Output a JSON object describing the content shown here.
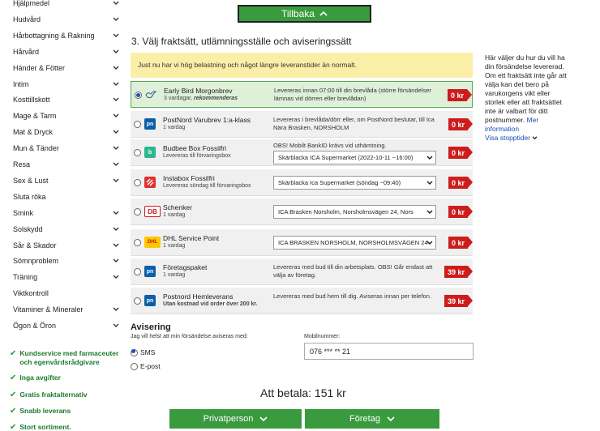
{
  "sidebar": {
    "categories": [
      {
        "label": "Hjälpmedel",
        "chevron": true
      },
      {
        "label": "Hudvård",
        "chevron": true
      },
      {
        "label": "Hårbottagning & Rakning",
        "chevron": true
      },
      {
        "label": "Hårvård",
        "chevron": true
      },
      {
        "label": "Händer & Fötter",
        "chevron": true
      },
      {
        "label": "Intim",
        "chevron": true
      },
      {
        "label": "Kosttillskott",
        "chevron": true
      },
      {
        "label": "Mage & Tarm",
        "chevron": true
      },
      {
        "label": "Mat & Dryck",
        "chevron": true
      },
      {
        "label": "Mun & Tänder",
        "chevron": true
      },
      {
        "label": "Resa",
        "chevron": true
      },
      {
        "label": "Sex & Lust",
        "chevron": true
      },
      {
        "label": "Sluta röka",
        "chevron": false
      },
      {
        "label": "Smink",
        "chevron": true
      },
      {
        "label": "Solskydd",
        "chevron": true
      },
      {
        "label": "Sår & Skador",
        "chevron": true
      },
      {
        "label": "Sömnproblem",
        "chevron": true
      },
      {
        "label": "Träning",
        "chevron": true
      },
      {
        "label": "Viktkontroll",
        "chevron": false
      },
      {
        "label": "Vitaminer & Mineraler",
        "chevron": true
      },
      {
        "label": "Ögon & Öron",
        "chevron": true
      }
    ],
    "usps": [
      "Kundservice med farmaceuter och egenvårdsrådgivare",
      "Inga avgifter",
      "Gratis fraktalternativ",
      "Snabb leverans",
      "Stort sortiment."
    ]
  },
  "header": {
    "back_button": "Tillbaka"
  },
  "section_title": "3. Välj fraktsätt, utlämningsställe och aviseringssätt",
  "notice": "Just nu har vi hög belastning och något längre leveranstider än normalt.",
  "options": [
    {
      "name": "Early Bird Morgonbrev",
      "sub": "3 vardagar, ",
      "sub_bold": "rekommenderas",
      "desc": "Levereras innan 07:00 till din brevlåda (större försändelser lämnas vid dörren eller brevlådan)",
      "select": "",
      "price": "0 kr",
      "selected": true,
      "logo": "bird-logo",
      "logo_color": "#ffffff"
    },
    {
      "name": "PostNord Varubrev 1:a-klass",
      "sub": "1 vardag",
      "sub_bold": "",
      "desc": "Levereras i brevlåda/dörr eller, om PostNord beslutar, till Ica Nära Brasken, NORSHOLM",
      "select": "",
      "price": "0 kr",
      "selected": false,
      "logo": "pn",
      "logo_color": "#0a5fa8"
    },
    {
      "name": "Budbee Box Fossilfri",
      "sub": "Levereras till förvaringsbox",
      "sub_bold": "",
      "desc": "OBS! Mobilt BankID krävs vid uthämtning.",
      "select": "Skärblacka ICA Supermarket (2022-10-11 ~16:00)",
      "price": "0 kr",
      "selected": false,
      "logo": "b",
      "logo_color": "#2bb88d"
    },
    {
      "name": "Instabox Fossilfri",
      "sub": "Levereras söndag till förvaringsbox",
      "sub_bold": "",
      "desc": "",
      "select": "Skärblacka Ica Supermarket (söndag ~09:40)",
      "price": "0 kr",
      "selected": false,
      "logo": "instabox",
      "logo_color": "#e0312f"
    },
    {
      "name": "Schenker",
      "sub": "1 vardag",
      "sub_bold": "",
      "desc": "",
      "select": "ICA Brasken Norsholm, Norsholmsvägen 24, Nors",
      "price": "0 kr",
      "selected": false,
      "logo": "DB",
      "logo_color": "#d0191e"
    },
    {
      "name": "DHL Service Point",
      "sub": "1 vardag",
      "sub_bold": "",
      "desc": "",
      "select": "ICA BRASKEN NORSHOLM, NORSHOLMSVÄGEN 24",
      "price": "0 kr",
      "selected": false,
      "logo": "DHL",
      "logo_color": "#fcc800"
    },
    {
      "name": "Företagspaket",
      "sub": "1 vardag",
      "sub_bold": "",
      "desc": "Levereras med bud till din arbetsplats. OBS! Går endast att välja av företag.",
      "select": "",
      "price": "39 kr",
      "selected": false,
      "logo": "pn",
      "logo_color": "#0a5fa8"
    },
    {
      "name": "Postnord Hemleverans",
      "sub": "",
      "sub_bold": "Utan kostnad vid order över 200 kr.",
      "desc": "Levereras med bud hem till dig. Aviseras innan per telefon.",
      "select": "",
      "price": "39 kr",
      "selected": false,
      "logo": "pn",
      "logo_color": "#0a5fa8"
    }
  ],
  "side_note": {
    "text": "Här väljer du hur du vill ha din försändelse levererad. Om ett fraktsätt inte går att välja kan det bero på varukorgens vikt eller storlek eller att fraktsättet inte är valbart för ditt postnummer.",
    "more_link": "Mer information",
    "stops_link": "Visa stopptider"
  },
  "avisering": {
    "title": "Avisering",
    "subtitle": "Jag vill helst att min försändelse aviseras med:",
    "sms_label": "SMS",
    "epost_label": "E-post",
    "mobile_label": "Mobilnummer:",
    "mobile_value": "076 *** ** 21"
  },
  "total": "Att betala: 151 kr",
  "bottom_buttons": {
    "private": "Privatperson",
    "company": "Företag"
  },
  "colors": {
    "green": "#3a9a3e",
    "red": "#cc1d1d",
    "notice": "#fbefa8",
    "link": "#1a4fb8"
  }
}
